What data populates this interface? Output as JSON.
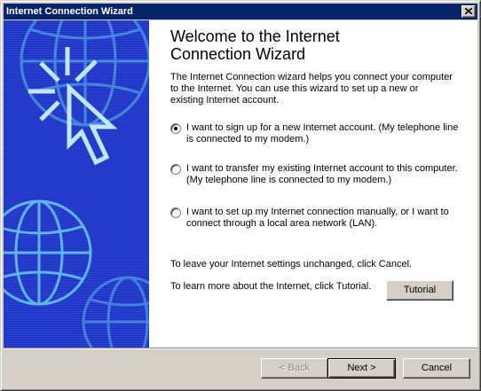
{
  "window": {
    "title": "Internet Connection Wizard",
    "close_symbol": "×"
  },
  "banner": {
    "icons": [
      "globe-icon",
      "cursor-arrow-icon"
    ],
    "colors": {
      "background": "#1e2fc8",
      "pattern": "#5fb4e8",
      "arrow": "#b8e0ff"
    }
  },
  "content": {
    "heading_line1": "Welcome to the Internet",
    "heading_line2": "Connection Wizard",
    "intro_line1": "The Internet Connection wizard helps you connect your computer",
    "intro_line2": "to the Internet.  You can use this wizard to set up a new or",
    "intro_line3": "existing Internet account.",
    "options": [
      {
        "line1": "I want to sign up for a new Internet account. (My telephone line",
        "line2": "is connected to my modem.)",
        "selected": true
      },
      {
        "line1": "I want to transfer my existing Internet account to this computer.",
        "line2": "(My telephone line is connected to my modem.)",
        "selected": false
      },
      {
        "line1": "I want to set up my Internet connection manually, or I want to",
        "line2": "connect through a local area network (LAN).",
        "selected": false
      }
    ],
    "cancel_note": "To leave your Internet settings unchanged, click Cancel.",
    "tutorial_note": "To learn more about the Internet, click Tutorial.",
    "tutorial_button": "Tutorial"
  },
  "footer": {
    "back_button": "< Back",
    "next_button": "Next >",
    "cancel_button": "Cancel"
  }
}
